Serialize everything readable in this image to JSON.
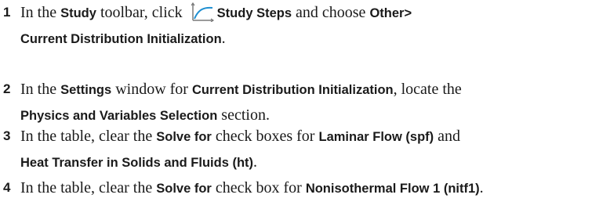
{
  "steps": [
    {
      "number": "1",
      "t1": "In the ",
      "b1": "Study",
      "t2": " toolbar, click ",
      "icon": "study-steps-icon",
      "b2": "Study Steps",
      "t3": " and choose ",
      "b3": "Other>",
      "b4": "Current Distribution Initialization",
      "t4": "."
    },
    {
      "number": "2",
      "t1": "In the ",
      "b1": "Settings",
      "t2": " window for ",
      "b2": "Current Distribution Initialization",
      "t3": ", locate the",
      "b3": "Physics and Variables Selection",
      "t4": " section."
    },
    {
      "number": "3",
      "t1": "In the table, clear the ",
      "b1": "Solve for",
      "t2": " check boxes for ",
      "b2": "Laminar Flow (spf)",
      "t3": " and",
      "b3": "Heat Transfer in Solids and Fluids (ht)",
      "t4": "."
    },
    {
      "number": "4",
      "t1": "In the table, clear the ",
      "b1": "Solve for",
      "t2": " check box for ",
      "b2": "Nonisothermal Flow 1 (nitf1)",
      "t3": "."
    }
  ],
  "colors": {
    "text": "#1a1a1a",
    "icon_curve": "#1f8fd1",
    "icon_axis": "#7a7a7a"
  }
}
